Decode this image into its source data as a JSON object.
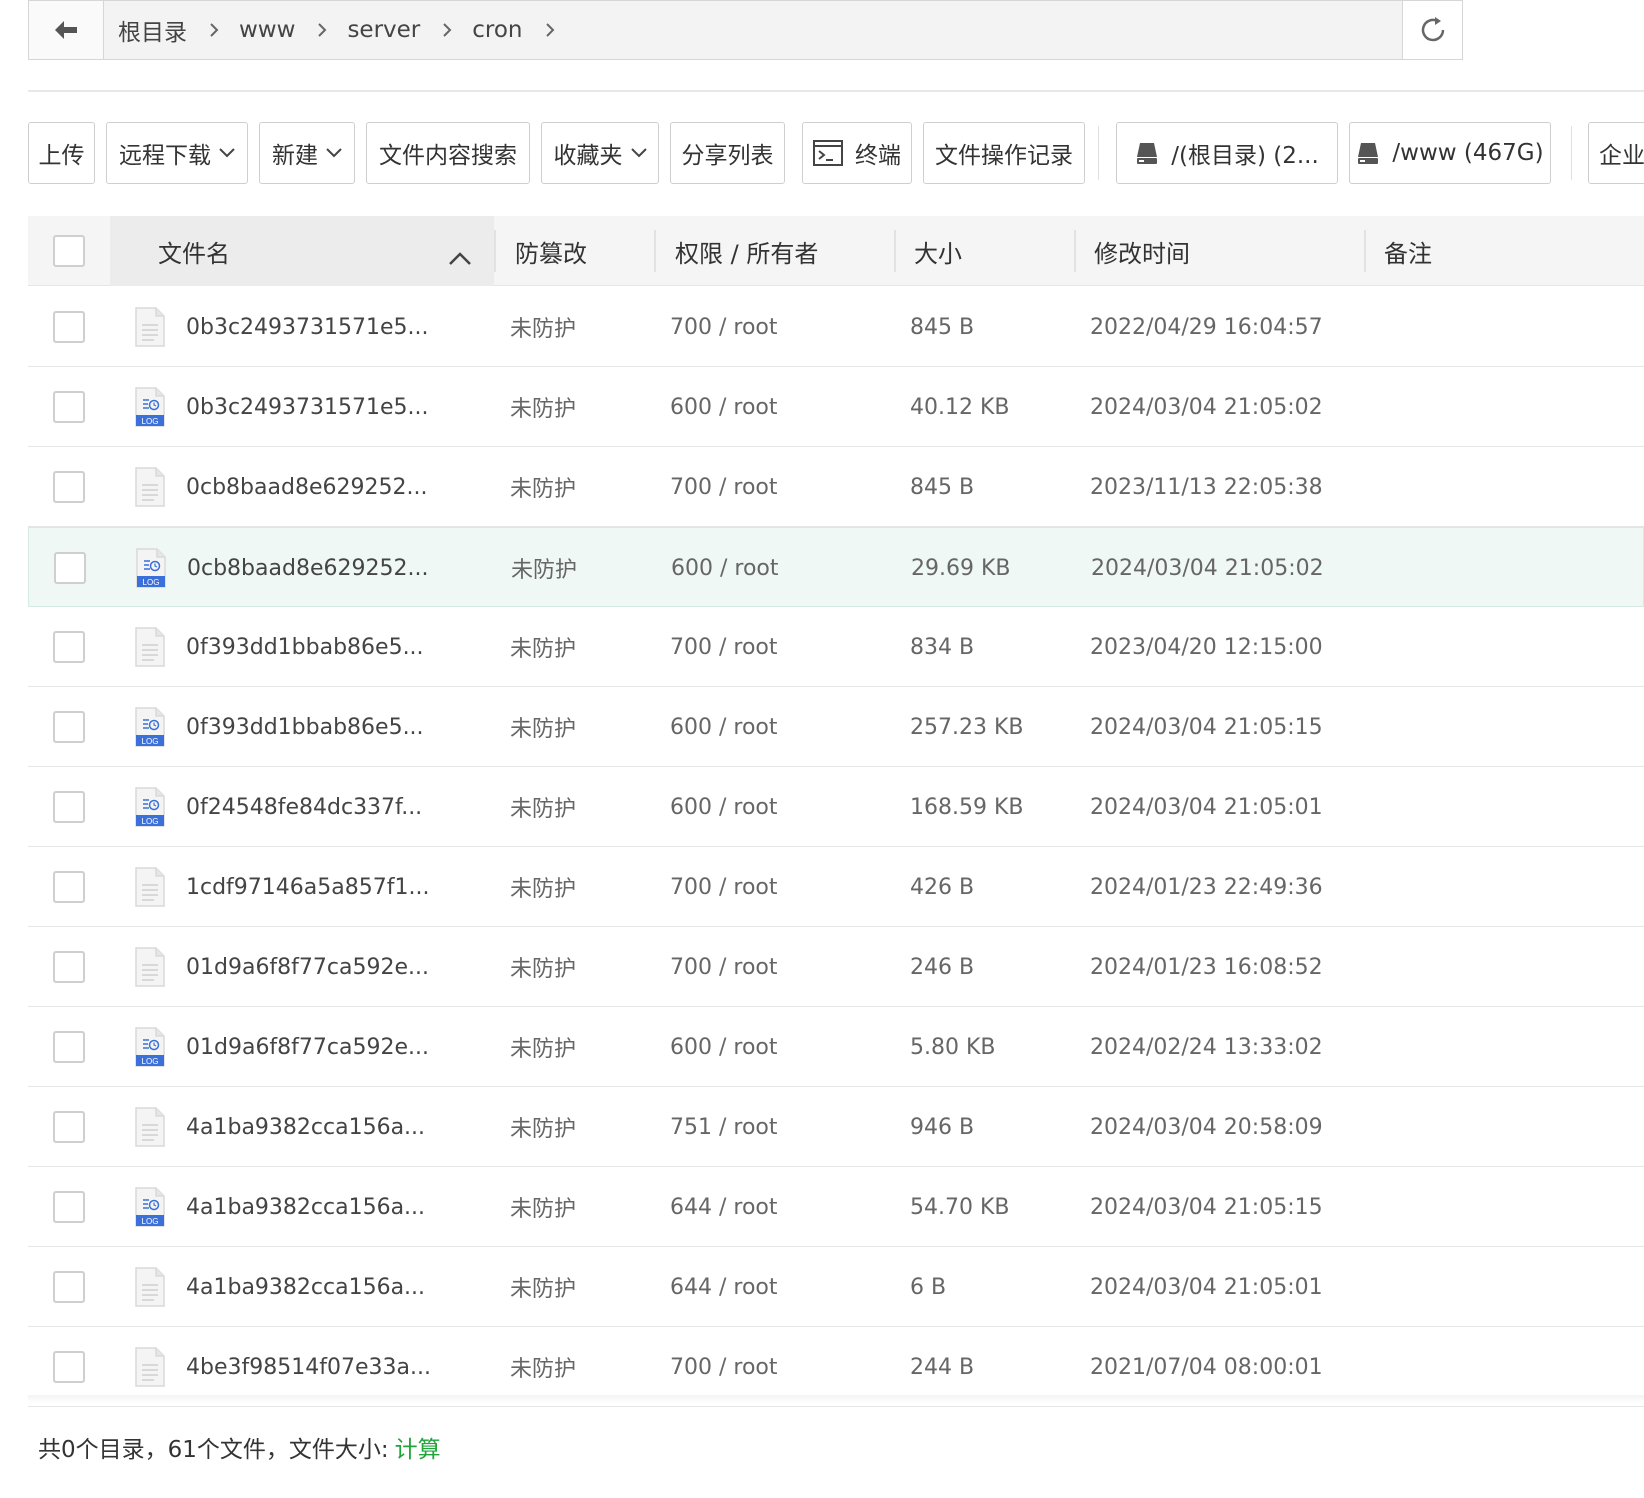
{
  "address": {
    "crumbs": [
      "根目录",
      "www",
      "server",
      "cron"
    ]
  },
  "toolbar": {
    "upload": "上传",
    "remote_download": "远程下载",
    "new": "新建",
    "content_search": "文件内容搜索",
    "favorites": "收藏夹",
    "share_list": "分享列表",
    "terminal": "终端",
    "op_log": "文件操作记录",
    "disk_root": "/(根目录) (2...",
    "disk_www": "/www (467G)",
    "enterprise": "企业"
  },
  "table": {
    "headers": {
      "name": "文件名",
      "protect": "防篡改",
      "perm": "权限 / 所有者",
      "size": "大小",
      "mtime": "修改时间",
      "note": "备注"
    },
    "rows": [
      {
        "icon": "file",
        "name": "0b3c2493731571e5...",
        "protect": "未防护",
        "perm": "700 / root",
        "size": "845 B",
        "mtime": "2022/04/29 16:04:57"
      },
      {
        "icon": "log",
        "name": "0b3c2493731571e5...",
        "protect": "未防护",
        "perm": "600 / root",
        "size": "40.12 KB",
        "mtime": "2024/03/04 21:05:02"
      },
      {
        "icon": "file",
        "name": "0cb8baad8e629252...",
        "protect": "未防护",
        "perm": "700 / root",
        "size": "845 B",
        "mtime": "2023/11/13 22:05:38"
      },
      {
        "icon": "log",
        "name": "0cb8baad8e629252...",
        "protect": "未防护",
        "perm": "600 / root",
        "size": "29.69 KB",
        "mtime": "2024/03/04 21:05:02",
        "highlight": true
      },
      {
        "icon": "file",
        "name": "0f393dd1bbab86e5...",
        "protect": "未防护",
        "perm": "700 / root",
        "size": "834 B",
        "mtime": "2023/04/20 12:15:00"
      },
      {
        "icon": "log",
        "name": "0f393dd1bbab86e5...",
        "protect": "未防护",
        "perm": "600 / root",
        "size": "257.23 KB",
        "mtime": "2024/03/04 21:05:15"
      },
      {
        "icon": "log",
        "name": "0f24548fe84dc337f...",
        "protect": "未防护",
        "perm": "600 / root",
        "size": "168.59 KB",
        "mtime": "2024/03/04 21:05:01"
      },
      {
        "icon": "file",
        "name": "1cdf97146a5a857f1...",
        "protect": "未防护",
        "perm": "700 / root",
        "size": "426 B",
        "mtime": "2024/01/23 22:49:36"
      },
      {
        "icon": "file",
        "name": "01d9a6f8f77ca592e...",
        "protect": "未防护",
        "perm": "700 / root",
        "size": "246 B",
        "mtime": "2024/01/23 16:08:52"
      },
      {
        "icon": "log",
        "name": "01d9a6f8f77ca592e...",
        "protect": "未防护",
        "perm": "600 / root",
        "size": "5.80 KB",
        "mtime": "2024/02/24 13:33:02"
      },
      {
        "icon": "file",
        "name": "4a1ba9382cca156a...",
        "protect": "未防护",
        "perm": "751 / root",
        "size": "946 B",
        "mtime": "2024/03/04 20:58:09"
      },
      {
        "icon": "log",
        "name": "4a1ba9382cca156a...",
        "protect": "未防护",
        "perm": "644 / root",
        "size": "54.70 KB",
        "mtime": "2024/03/04 21:05:15"
      },
      {
        "icon": "file",
        "name": "4a1ba9382cca156a...",
        "protect": "未防护",
        "perm": "644 / root",
        "size": "6 B",
        "mtime": "2024/03/04 21:05:01"
      },
      {
        "icon": "file",
        "name": "4be3f98514f07e33a...",
        "protect": "未防护",
        "perm": "700 / root",
        "size": "244 B",
        "mtime": "2021/07/04 08:00:01"
      }
    ]
  },
  "footer": {
    "summary": "共0个目录，61个文件，文件大小:",
    "calc": "计算"
  },
  "colors": {
    "accent_green": "#20a53a",
    "log_blue": "#3b6fd9",
    "highlight_row": "#eff8f4"
  }
}
